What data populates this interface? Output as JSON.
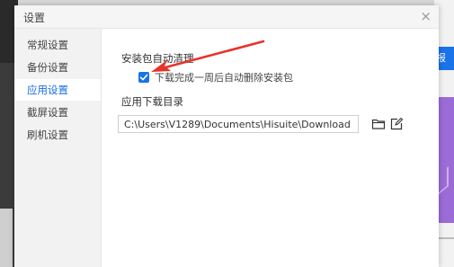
{
  "background": {
    "right_button_label": "报",
    "accent": "#1a73e8",
    "banner_color": "#9b6bd7"
  },
  "dialog": {
    "title": "设置",
    "close_glyph": "×"
  },
  "sidebar": {
    "items": [
      {
        "label": "常规设置"
      },
      {
        "label": "备份设置"
      },
      {
        "label": "应用设置",
        "active": true
      },
      {
        "label": "截屏设置"
      },
      {
        "label": "刷机设置"
      }
    ]
  },
  "content": {
    "auto_clean": {
      "title": "安装包自动清理",
      "checkbox_label": "下载完成一周后自动删除安装包",
      "checked": true
    },
    "download_dir": {
      "title": "应用下载目录",
      "path": "C:\\Users\\V1289\\Documents\\Hisuite\\Download",
      "browse_icon": "folder-icon",
      "open_icon": "edit-icon"
    }
  },
  "annotation": {
    "arrow_color": "#e8332a"
  }
}
